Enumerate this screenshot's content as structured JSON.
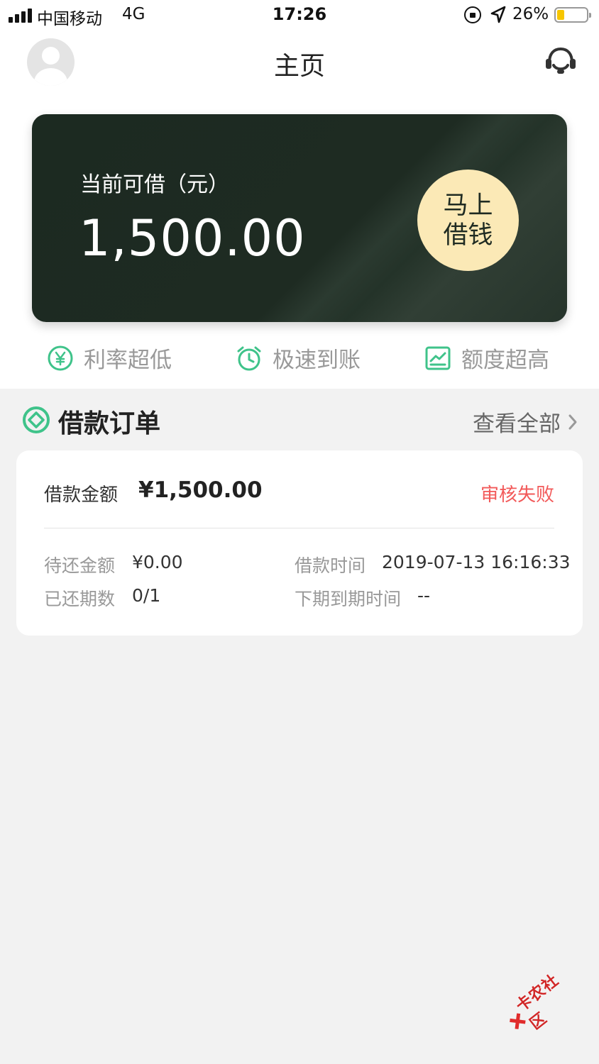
{
  "status_bar": {
    "carrier": "中国移动",
    "network": "4G",
    "time": "17:26",
    "battery_percent": "26%",
    "battery_level": 0.26,
    "icons": [
      "signal-icon",
      "orientation-lock-icon",
      "location-arrow-icon",
      "battery-icon"
    ]
  },
  "header": {
    "title": "主页",
    "left_icon": "avatar-icon",
    "right_icon": "customer-service-headset-icon"
  },
  "loan_card": {
    "label": "当前可借（元）",
    "amount": "1,500.00",
    "button_line1": "马上",
    "button_line2": "借钱"
  },
  "features": [
    {
      "label": "利率超低",
      "icon": "yen-circle-icon"
    },
    {
      "label": "极速到账",
      "icon": "alarm-clock-icon"
    },
    {
      "label": "额度超高",
      "icon": "chart-trend-icon"
    }
  ],
  "orders": {
    "title": "借款订单",
    "view_all": "查看全部",
    "item": {
      "amount_label": "借款金额",
      "amount_value": "¥1,500.00",
      "status": "审核失败",
      "pending_label": "待还金额",
      "pending_value": "¥0.00",
      "time_label": "借款时间",
      "time_value": "2019-07-13 16:16:33",
      "periods_label": "已还期数",
      "periods_value": "0/1",
      "next_due_label": "下期到期时间",
      "next_due_value": "--"
    }
  },
  "colors": {
    "accent_green": "#3fc38a",
    "card_dark": "#1c2a21",
    "button_cream": "#fbe9b6",
    "status_red": "#f25959",
    "battery_yellow": "#f7c600"
  },
  "watermark": "卡农社区"
}
